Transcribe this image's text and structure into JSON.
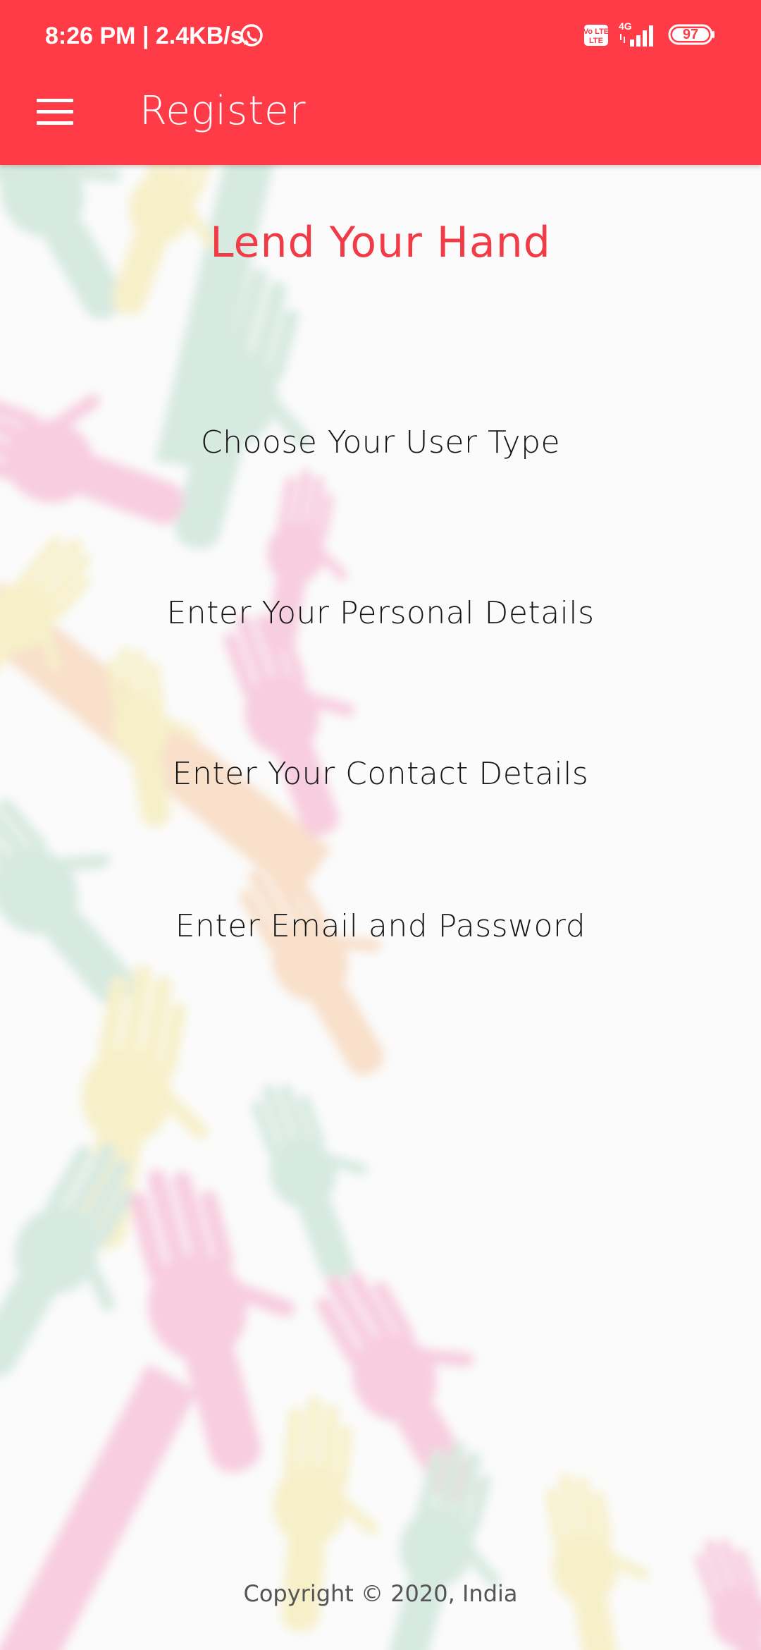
{
  "status_bar": {
    "time_and_speed": "8:26 PM | 2.4KB/s",
    "volte_label": "Vo LTE",
    "network_label": "4G",
    "battery": "97",
    "icons": [
      "whatsapp-icon",
      "volte-icon",
      "signal-icon",
      "battery-icon"
    ]
  },
  "toolbar": {
    "title": "Register",
    "menu_icon": "hamburger-menu-icon"
  },
  "main": {
    "title": "Lend Your Hand",
    "steps": [
      {
        "label": "Choose Your User Type"
      },
      {
        "label": "Enter Your Personal Details"
      },
      {
        "label": "Enter Your Contact Details"
      },
      {
        "label": "Enter Email and Password"
      }
    ],
    "copyright": "Copyright © 2020, India"
  },
  "colors": {
    "accent": "#fe3b47",
    "title": "#f13b47",
    "text": "#161616",
    "background": "#fbfbfb"
  }
}
